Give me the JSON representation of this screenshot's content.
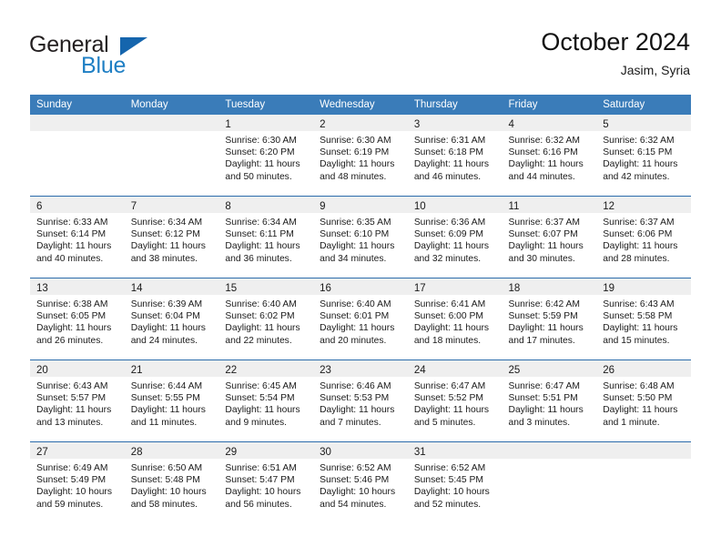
{
  "brand": {
    "line1": "General",
    "line2": "Blue",
    "triangle_color": "#1565ad",
    "blue_text_color": "#1f7fc4"
  },
  "header": {
    "title": "October 2024",
    "subtitle": "Jasim, Syria"
  },
  "theme": {
    "header_row_bg": "#3a7cb9",
    "header_row_text": "#ffffff",
    "daynum_band_bg": "#efefef",
    "row_divider": "#2b6cab",
    "cell_bg": "#ffffff"
  },
  "weekday_headers": [
    "Sunday",
    "Monday",
    "Tuesday",
    "Wednesday",
    "Thursday",
    "Friday",
    "Saturday"
  ],
  "labels": {
    "sunrise_prefix": "Sunrise:",
    "sunset_prefix": "Sunset:",
    "daylight_prefix": "Daylight:"
  },
  "weeks": [
    [
      {
        "empty": true
      },
      {
        "empty": true
      },
      {
        "day": "1",
        "sunrise": "Sunrise: 6:30 AM",
        "sunset": "Sunset: 6:20 PM",
        "daylight1": "Daylight: 11 hours",
        "daylight2": "and 50 minutes."
      },
      {
        "day": "2",
        "sunrise": "Sunrise: 6:30 AM",
        "sunset": "Sunset: 6:19 PM",
        "daylight1": "Daylight: 11 hours",
        "daylight2": "and 48 minutes."
      },
      {
        "day": "3",
        "sunrise": "Sunrise: 6:31 AM",
        "sunset": "Sunset: 6:18 PM",
        "daylight1": "Daylight: 11 hours",
        "daylight2": "and 46 minutes."
      },
      {
        "day": "4",
        "sunrise": "Sunrise: 6:32 AM",
        "sunset": "Sunset: 6:16 PM",
        "daylight1": "Daylight: 11 hours",
        "daylight2": "and 44 minutes."
      },
      {
        "day": "5",
        "sunrise": "Sunrise: 6:32 AM",
        "sunset": "Sunset: 6:15 PM",
        "daylight1": "Daylight: 11 hours",
        "daylight2": "and 42 minutes."
      }
    ],
    [
      {
        "day": "6",
        "sunrise": "Sunrise: 6:33 AM",
        "sunset": "Sunset: 6:14 PM",
        "daylight1": "Daylight: 11 hours",
        "daylight2": "and 40 minutes."
      },
      {
        "day": "7",
        "sunrise": "Sunrise: 6:34 AM",
        "sunset": "Sunset: 6:12 PM",
        "daylight1": "Daylight: 11 hours",
        "daylight2": "and 38 minutes."
      },
      {
        "day": "8",
        "sunrise": "Sunrise: 6:34 AM",
        "sunset": "Sunset: 6:11 PM",
        "daylight1": "Daylight: 11 hours",
        "daylight2": "and 36 minutes."
      },
      {
        "day": "9",
        "sunrise": "Sunrise: 6:35 AM",
        "sunset": "Sunset: 6:10 PM",
        "daylight1": "Daylight: 11 hours",
        "daylight2": "and 34 minutes."
      },
      {
        "day": "10",
        "sunrise": "Sunrise: 6:36 AM",
        "sunset": "Sunset: 6:09 PM",
        "daylight1": "Daylight: 11 hours",
        "daylight2": "and 32 minutes."
      },
      {
        "day": "11",
        "sunrise": "Sunrise: 6:37 AM",
        "sunset": "Sunset: 6:07 PM",
        "daylight1": "Daylight: 11 hours",
        "daylight2": "and 30 minutes."
      },
      {
        "day": "12",
        "sunrise": "Sunrise: 6:37 AM",
        "sunset": "Sunset: 6:06 PM",
        "daylight1": "Daylight: 11 hours",
        "daylight2": "and 28 minutes."
      }
    ],
    [
      {
        "day": "13",
        "sunrise": "Sunrise: 6:38 AM",
        "sunset": "Sunset: 6:05 PM",
        "daylight1": "Daylight: 11 hours",
        "daylight2": "and 26 minutes."
      },
      {
        "day": "14",
        "sunrise": "Sunrise: 6:39 AM",
        "sunset": "Sunset: 6:04 PM",
        "daylight1": "Daylight: 11 hours",
        "daylight2": "and 24 minutes."
      },
      {
        "day": "15",
        "sunrise": "Sunrise: 6:40 AM",
        "sunset": "Sunset: 6:02 PM",
        "daylight1": "Daylight: 11 hours",
        "daylight2": "and 22 minutes."
      },
      {
        "day": "16",
        "sunrise": "Sunrise: 6:40 AM",
        "sunset": "Sunset: 6:01 PM",
        "daylight1": "Daylight: 11 hours",
        "daylight2": "and 20 minutes."
      },
      {
        "day": "17",
        "sunrise": "Sunrise: 6:41 AM",
        "sunset": "Sunset: 6:00 PM",
        "daylight1": "Daylight: 11 hours",
        "daylight2": "and 18 minutes."
      },
      {
        "day": "18",
        "sunrise": "Sunrise: 6:42 AM",
        "sunset": "Sunset: 5:59 PM",
        "daylight1": "Daylight: 11 hours",
        "daylight2": "and 17 minutes."
      },
      {
        "day": "19",
        "sunrise": "Sunrise: 6:43 AM",
        "sunset": "Sunset: 5:58 PM",
        "daylight1": "Daylight: 11 hours",
        "daylight2": "and 15 minutes."
      }
    ],
    [
      {
        "day": "20",
        "sunrise": "Sunrise: 6:43 AM",
        "sunset": "Sunset: 5:57 PM",
        "daylight1": "Daylight: 11 hours",
        "daylight2": "and 13 minutes."
      },
      {
        "day": "21",
        "sunrise": "Sunrise: 6:44 AM",
        "sunset": "Sunset: 5:55 PM",
        "daylight1": "Daylight: 11 hours",
        "daylight2": "and 11 minutes."
      },
      {
        "day": "22",
        "sunrise": "Sunrise: 6:45 AM",
        "sunset": "Sunset: 5:54 PM",
        "daylight1": "Daylight: 11 hours",
        "daylight2": "and 9 minutes."
      },
      {
        "day": "23",
        "sunrise": "Sunrise: 6:46 AM",
        "sunset": "Sunset: 5:53 PM",
        "daylight1": "Daylight: 11 hours",
        "daylight2": "and 7 minutes."
      },
      {
        "day": "24",
        "sunrise": "Sunrise: 6:47 AM",
        "sunset": "Sunset: 5:52 PM",
        "daylight1": "Daylight: 11 hours",
        "daylight2": "and 5 minutes."
      },
      {
        "day": "25",
        "sunrise": "Sunrise: 6:47 AM",
        "sunset": "Sunset: 5:51 PM",
        "daylight1": "Daylight: 11 hours",
        "daylight2": "and 3 minutes."
      },
      {
        "day": "26",
        "sunrise": "Sunrise: 6:48 AM",
        "sunset": "Sunset: 5:50 PM",
        "daylight1": "Daylight: 11 hours",
        "daylight2": "and 1 minute."
      }
    ],
    [
      {
        "day": "27",
        "sunrise": "Sunrise: 6:49 AM",
        "sunset": "Sunset: 5:49 PM",
        "daylight1": "Daylight: 10 hours",
        "daylight2": "and 59 minutes."
      },
      {
        "day": "28",
        "sunrise": "Sunrise: 6:50 AM",
        "sunset": "Sunset: 5:48 PM",
        "daylight1": "Daylight: 10 hours",
        "daylight2": "and 58 minutes."
      },
      {
        "day": "29",
        "sunrise": "Sunrise: 6:51 AM",
        "sunset": "Sunset: 5:47 PM",
        "daylight1": "Daylight: 10 hours",
        "daylight2": "and 56 minutes."
      },
      {
        "day": "30",
        "sunrise": "Sunrise: 6:52 AM",
        "sunset": "Sunset: 5:46 PM",
        "daylight1": "Daylight: 10 hours",
        "daylight2": "and 54 minutes."
      },
      {
        "day": "31",
        "sunrise": "Sunrise: 6:52 AM",
        "sunset": "Sunset: 5:45 PM",
        "daylight1": "Daylight: 10 hours",
        "daylight2": "and 52 minutes."
      },
      {
        "empty": true
      },
      {
        "empty": true
      }
    ]
  ]
}
